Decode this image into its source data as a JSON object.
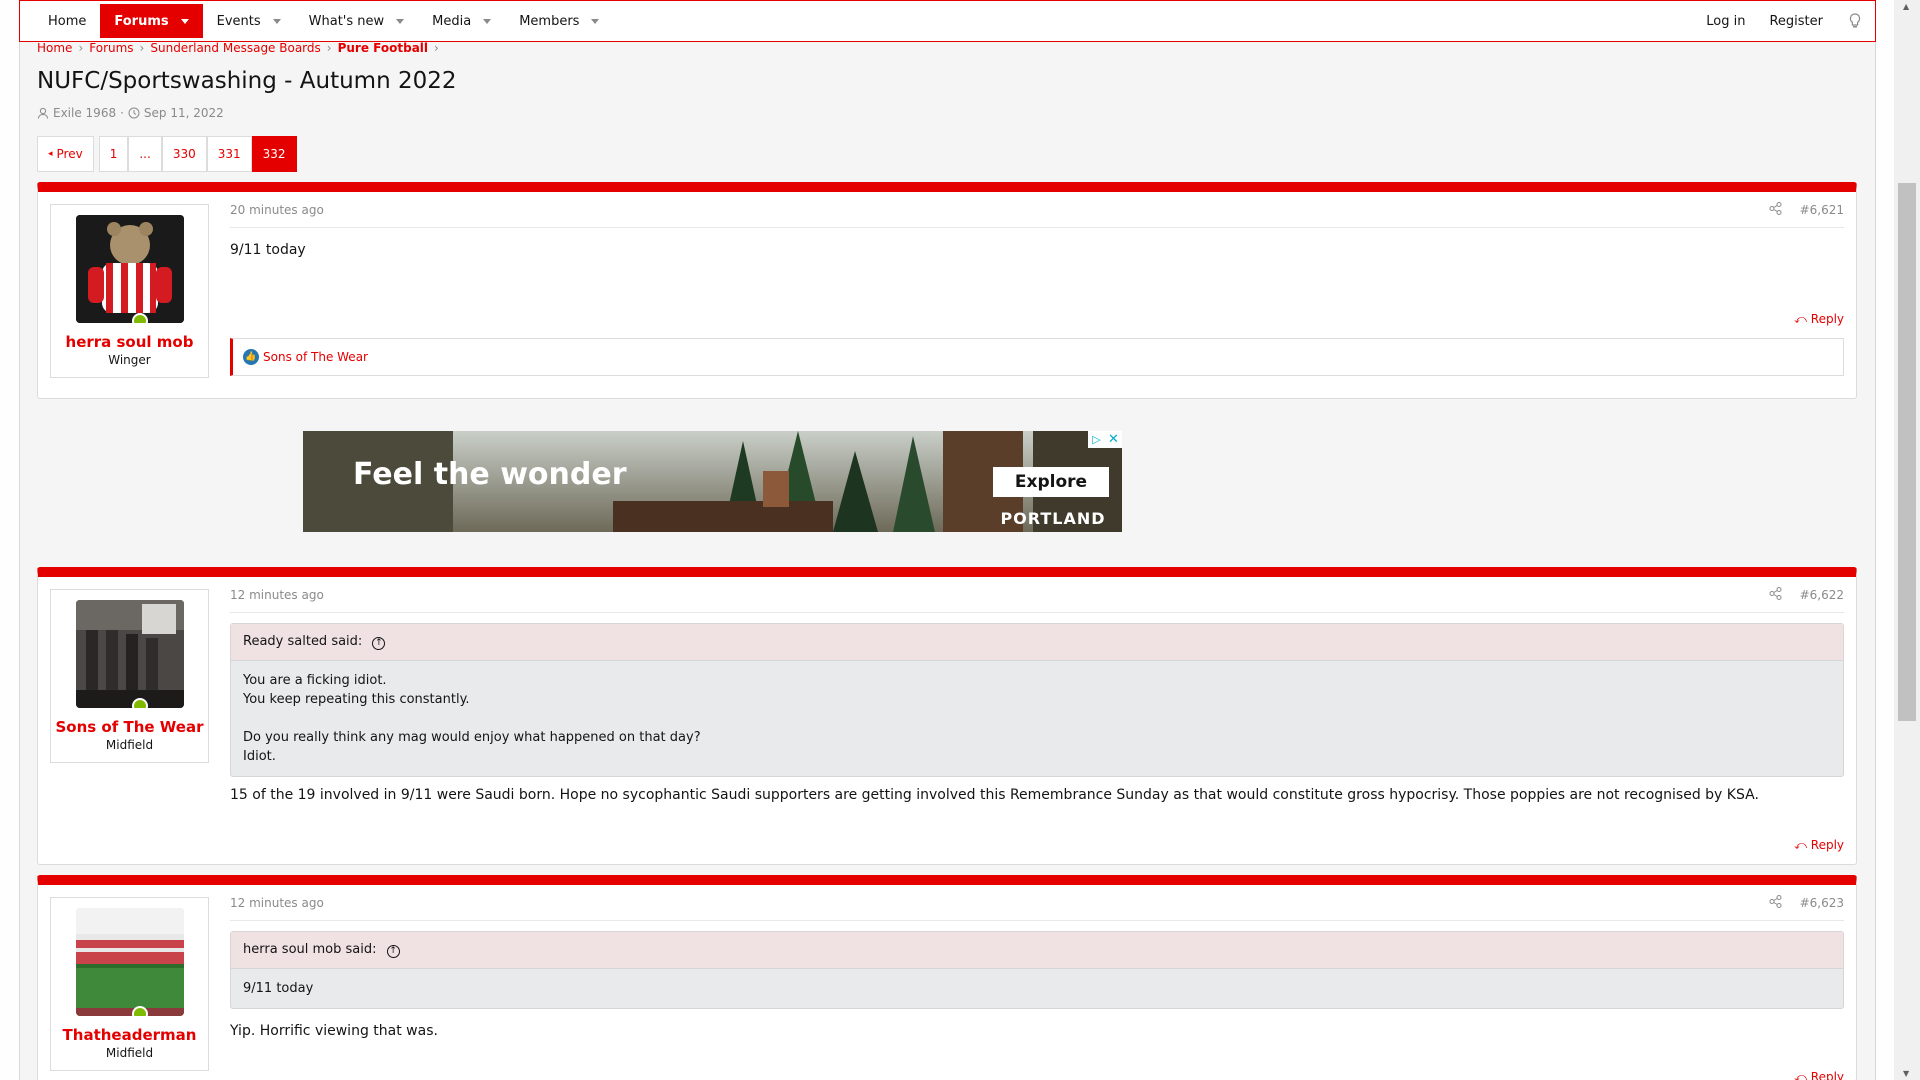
{
  "nav": {
    "tabs": [
      {
        "label": "Home",
        "caret": false,
        "active": false
      },
      {
        "label": "Forums",
        "caret": true,
        "active": true
      },
      {
        "label": "Events",
        "caret": true,
        "active": false
      },
      {
        "label": "What's new",
        "caret": true,
        "active": false
      },
      {
        "label": "Media",
        "caret": true,
        "active": false
      },
      {
        "label": "Members",
        "caret": true,
        "active": false
      }
    ],
    "login": "Log in",
    "register": "Register"
  },
  "breadcrumb": [
    "Home",
    "Forums",
    "Sunderland Message Boards",
    "Pure Football"
  ],
  "thread": {
    "title": "NUFC/Sportswashing - Autumn 2022",
    "author": "Exile 1968",
    "date": "Sep 11, 2022"
  },
  "pager": {
    "prev": "Prev",
    "pages": [
      "1",
      "...",
      "330",
      "331",
      "332"
    ],
    "current": "332"
  },
  "posts": [
    {
      "user": "herra soul mob",
      "user_title": "Winger",
      "time": "20 minutes ago",
      "number": "#6,621",
      "body": "9/11 today",
      "reply": "Reply",
      "reaction_user": "Sons of The Wear"
    },
    {
      "user": "Sons of The Wear",
      "user_title": "Midfield",
      "time": "12 minutes ago",
      "number": "#6,622",
      "quote_head": "Ready salted said:",
      "quote_lines": [
        "You are a ficking idiot.",
        "You keep repeating this constantly.",
        "",
        "Do you really think any mag would enjoy what happened on that day?",
        "Idiot."
      ],
      "body": "15 of the 19 involved in 9/11 were Saudi born. Hope no sycophantic Saudi supporters are getting involved this Remembrance Sunday as that would constitute gross hypocrisy. Those poppies are not recognised by KSA.",
      "reply": "Reply"
    },
    {
      "user": "Thatheaderman",
      "user_title": "Midfield",
      "time": "12 minutes ago",
      "number": "#6,623",
      "quote_head": "herra soul mob said:",
      "quote_lines": [
        "9/11 today"
      ],
      "body": "Yip. Horrific viewing that was.",
      "reply": "Reply"
    }
  ],
  "ad": {
    "headline": "Feel the wonder",
    "cta": "Explore",
    "brand": "PORTLAND"
  },
  "colors": {
    "accent": "#e50000",
    "online": "#7fb900"
  }
}
